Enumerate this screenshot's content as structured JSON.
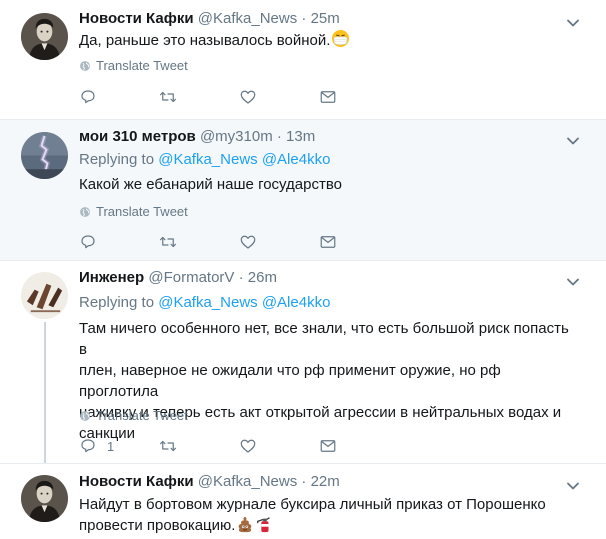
{
  "tweets": [
    {
      "name": "Новости Кафки",
      "handle": "@Kafka_News",
      "time": "25m",
      "text": "Да, раньше это называлось войной.",
      "translate": "Translate Tweet",
      "reply_count": ""
    },
    {
      "name": "мои 310 метров",
      "handle": "@my310m",
      "time": "13m",
      "replying_label": "Replying to",
      "mentions": "@Kafka_News @Ale4kko",
      "text": "Какой же ебанарий наше государство",
      "translate": "Translate Tweet",
      "reply_count": ""
    },
    {
      "name": "Инженер",
      "handle": "@FormatorV",
      "time": "26m",
      "replying_label": "Replying to",
      "mentions": "@Kafka_News @Ale4kko",
      "text_lines": [
        "Там ничего особенного нет, все знали, что есть большой риск попасть в",
        "плен, наверное не ожидали что рф применит оружие, но рф проглотила",
        "наживку и теперь есть акт открытой агрессии в нейтральных водах и",
        "санкции"
      ],
      "translate": "Translate Tweet",
      "reply_count": "1"
    },
    {
      "name": "Новости Кафки",
      "handle": "@Kafka_News",
      "time": "22m",
      "text_lines": [
        "Найдут в бортовом журнале буксира личный приказ от Порошенко",
        "провести провокацию."
      ]
    }
  ],
  "separator": "·",
  "colors": {
    "link": "#1da1f2",
    "muted": "#657786",
    "text": "#14171a",
    "highlight_bg": "#f5f8fa",
    "border": "#e6ecf0"
  },
  "icons": [
    "reply-icon",
    "retweet-icon",
    "like-icon",
    "direct-message-icon",
    "globe-icon",
    "chevron-down-icon",
    "face-with-medical-mask-emoji",
    "pile-of-poo-emoji",
    "fire-extinguisher-emoji"
  ]
}
